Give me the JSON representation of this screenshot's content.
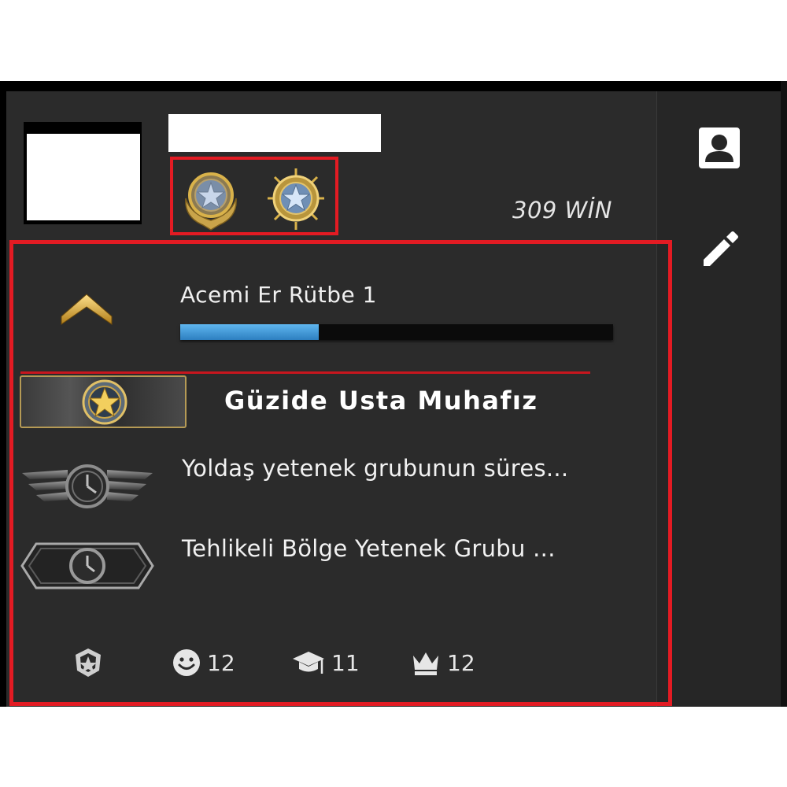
{
  "profile": {
    "wins_text": "309 WİN"
  },
  "rank": {
    "label": "Acemi Er Rütbe 1",
    "xp_progress": 0.32
  },
  "items": [
    {
      "label": "Güzide Usta Muhafız",
      "icon": "gold-star-coin-icon"
    },
    {
      "label": "Yoldaş yetenek grubunun süres...",
      "icon": "winged-clock-icon"
    },
    {
      "label": "Tehlikeli Bölge Yetenek Grubu ...",
      "icon": "hexagon-clock-icon"
    }
  ],
  "stats": {
    "service_icon": "service-medal-icon",
    "friendly": {
      "icon": "smiley-icon",
      "value": "12"
    },
    "teacher": {
      "icon": "graduation-cap-icon",
      "value": "11"
    },
    "leader": {
      "icon": "crown-icon",
      "value": "12"
    }
  },
  "sidebar": {
    "buttons": [
      "profile-icon",
      "edit-pencil-icon"
    ]
  },
  "colors": {
    "panel_bg": "#2b2b2b",
    "highlight_red": "#e31b23",
    "xp_blue": "#4aa3e0",
    "gold": "#d9b24a"
  }
}
